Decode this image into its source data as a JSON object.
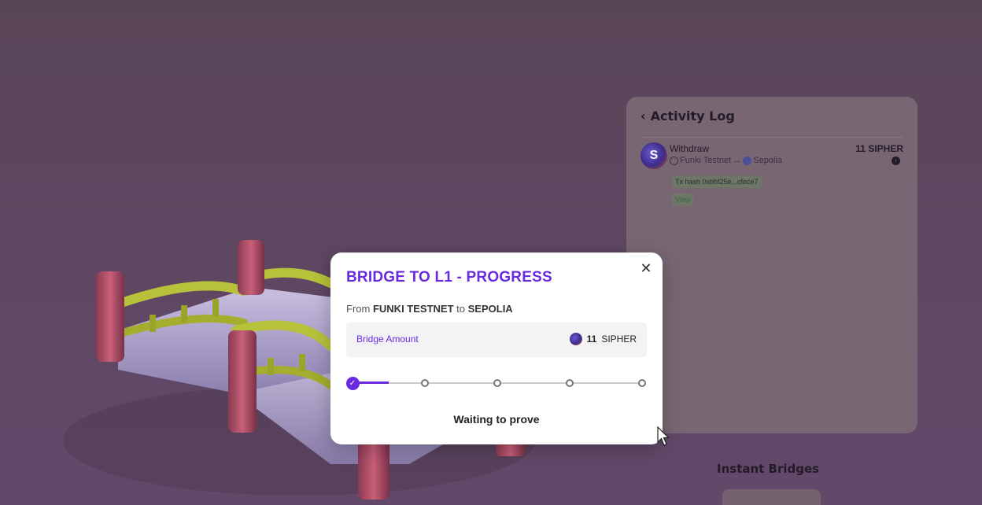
{
  "activity_log": {
    "title": "Activity Log",
    "item": {
      "token_initial": "S",
      "type": "Withdraw",
      "from": "Funki Testnet",
      "arrow": "→",
      "to": "Sepolia",
      "amount": "11 SIPHER",
      "tx_hash": "Tx hash 0xbbf25e...cfece7",
      "view_label": "View"
    }
  },
  "instant_bridges": {
    "title": "Instant Bridges"
  },
  "modal": {
    "title": "BRIDGE TO L1 - PROGRESS",
    "close_glyph": "✕",
    "route": {
      "from_word": "From",
      "from": "FUNKI TESTNET",
      "to_word": "to",
      "to": "SEPOLIA"
    },
    "amount_label": "Bridge Amount",
    "amount_number": "11",
    "amount_token": "SIPHER",
    "steps_total": 5,
    "steps_completed": 1,
    "status": "Waiting to prove"
  },
  "colors": {
    "accent": "#6a2be0",
    "backdrop": "#5f4762"
  },
  "icons": [
    "chevron-left-icon",
    "close-icon",
    "check-icon",
    "sipher-token-icon",
    "ethereum-icon",
    "network-icon",
    "status-arrow-icon",
    "mouse-cursor-icon"
  ]
}
